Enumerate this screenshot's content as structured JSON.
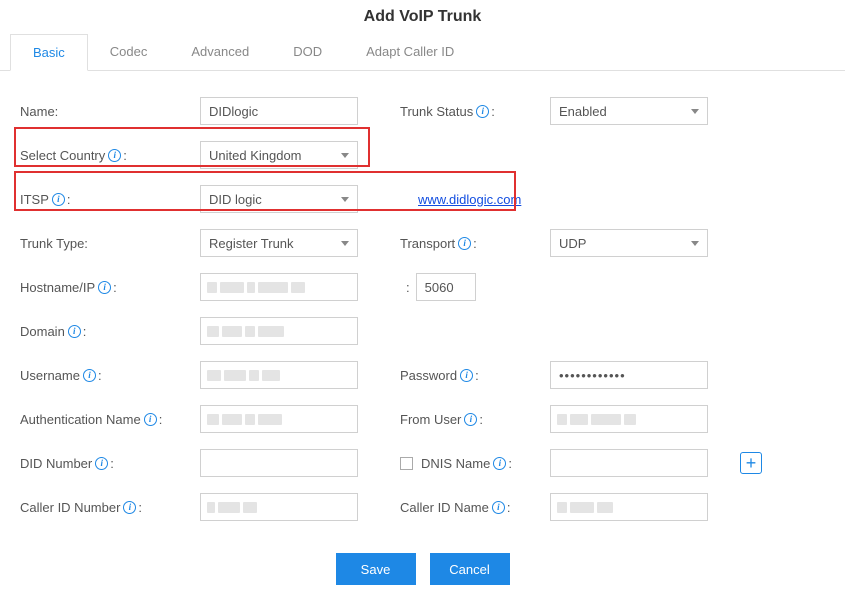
{
  "title": "Add VoIP Trunk",
  "tabs": [
    "Basic",
    "Codec",
    "Advanced",
    "DOD",
    "Adapt Caller ID"
  ],
  "activeTab": 0,
  "labels": {
    "name": "Name:",
    "trunkStatus": "Trunk Status",
    "selectCountry": "Select Country",
    "itsp": "ITSP",
    "trunkType": "Trunk Type:",
    "transport": "Transport",
    "hostnameIp": "Hostname/IP",
    "domain": "Domain",
    "username": "Username",
    "password": "Password",
    "authName": "Authentication Name",
    "fromUser": "From User",
    "didNumber": "DID Number",
    "dnisName": "DNIS Name",
    "callerIdNumber": "Caller ID Number",
    "callerIdName": "Caller ID Name"
  },
  "colon": ":",
  "values": {
    "name": "DIDlogic",
    "trunkStatus": "Enabled",
    "selectCountry": "United Kingdom",
    "itsp": "DID logic",
    "itspLink": "www.didlogic.com",
    "trunkType": "Register Trunk",
    "transport": "UDP",
    "port": "5060",
    "password": "••••••••••••",
    "didNumber": "",
    "dnisName": "",
    "dnisChecked": false
  },
  "buttons": {
    "save": "Save",
    "cancel": "Cancel"
  }
}
